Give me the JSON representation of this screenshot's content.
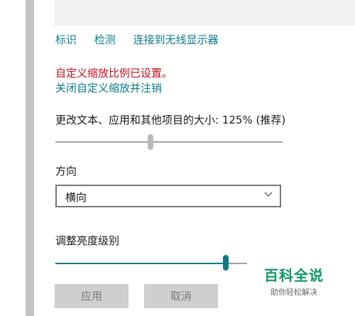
{
  "links": {
    "identify": "标识",
    "detect": "检测",
    "connect_wireless": "连接到无线显示器"
  },
  "custom_scaling": {
    "warning": "自定义缩放比例已设置。",
    "signout_link": "关闭自定义缩放并注销"
  },
  "scale": {
    "label": "更改文本、应用和其他项目的大小: 125% (推荐)",
    "level": 0.42
  },
  "orientation": {
    "label": "方向",
    "selected": "横向"
  },
  "brightness": {
    "label": "调整亮度级别",
    "level": 0.89,
    "accent": "#0f7b83"
  },
  "buttons": {
    "apply": "应用",
    "cancel": "取消"
  },
  "watermark": {
    "title": "百科全说",
    "subtitle": "助你轻松解决"
  }
}
